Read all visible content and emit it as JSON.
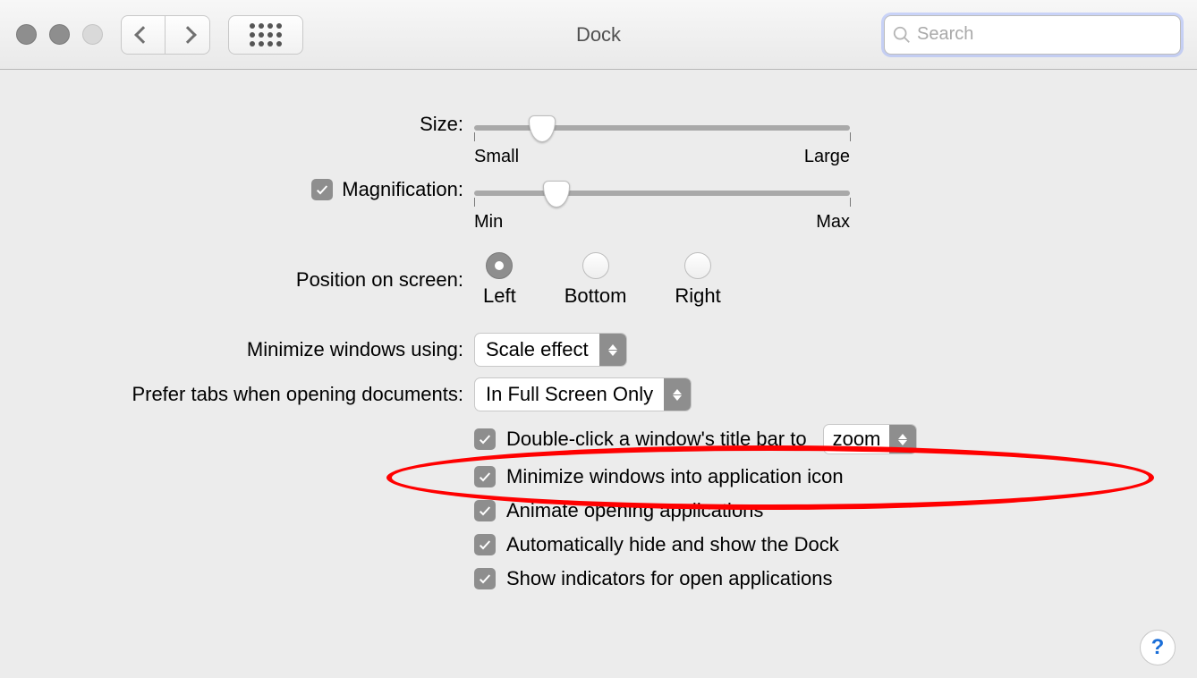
{
  "toolbar": {
    "title": "Dock",
    "search_placeholder": "Search"
  },
  "size": {
    "label": "Size:",
    "min_label": "Small",
    "max_label": "Large",
    "value_percent": 18
  },
  "magnification": {
    "label": "Magnification:",
    "checked": true,
    "min_label": "Min",
    "max_label": "Max",
    "value_percent": 22
  },
  "position": {
    "label": "Position on screen:",
    "options": [
      "Left",
      "Bottom",
      "Right"
    ],
    "selected_index": 0
  },
  "minimize_using": {
    "label": "Minimize windows using:",
    "value": "Scale effect"
  },
  "prefer_tabs": {
    "label": "Prefer tabs when opening documents:",
    "value": "In Full Screen Only"
  },
  "double_click": {
    "checked": true,
    "label": "Double-click a window's title bar to",
    "value": "zoom"
  },
  "checks": [
    {
      "checked": true,
      "label": "Minimize windows into application icon"
    },
    {
      "checked": true,
      "label": "Animate opening applications"
    },
    {
      "checked": true,
      "label": "Automatically hide and show the Dock"
    },
    {
      "checked": true,
      "label": "Show indicators for open applications"
    }
  ],
  "help": "?"
}
